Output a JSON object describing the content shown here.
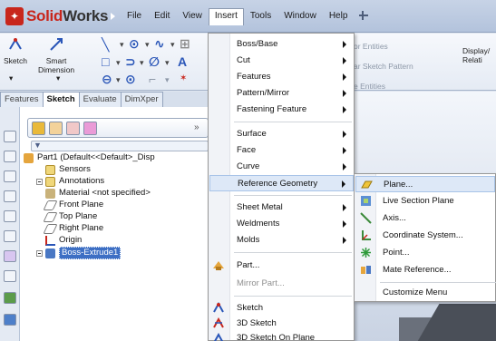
{
  "app": {
    "name_red": "Solid",
    "name_dark": "Works"
  },
  "menubar": {
    "menus": [
      "File",
      "Edit",
      "View",
      "Insert",
      "Tools",
      "Window",
      "Help"
    ],
    "active_index": 3
  },
  "ribbon": {
    "sketch_label": "Sketch",
    "smart_dim_label_1": "Smart",
    "smart_dim_label_2": "Dimension",
    "right_items": [
      "or Entities",
      "ar Sketch Pattern",
      "e Entities"
    ],
    "display_label_1": "Display/",
    "display_label_2": "Relati"
  },
  "tabs": [
    "Features",
    "Sketch",
    "Evaluate",
    "DimXper"
  ],
  "selected_tab": 1,
  "tree": {
    "part": "Part1  (Default<<Default>_Disp",
    "nodes": [
      "Sensors",
      "Annotations",
      "Material <not specified>",
      "Front Plane",
      "Top Plane",
      "Right Plane",
      "Origin",
      "Boss-Extrude1"
    ]
  },
  "insert_menu": {
    "items": [
      {
        "label": "Boss/Base",
        "submenu": true
      },
      {
        "label": "Cut",
        "submenu": true
      },
      {
        "label": "Features",
        "submenu": true
      },
      {
        "label": "Pattern/Mirror",
        "submenu": true
      },
      {
        "label": "Fastening Feature",
        "submenu": true
      },
      {
        "label": "Surface",
        "submenu": true
      },
      {
        "label": "Face",
        "submenu": true
      },
      {
        "label": "Curve",
        "submenu": true
      },
      {
        "label": "Reference Geometry",
        "submenu": true
      },
      {
        "label": "Sheet Metal",
        "submenu": true
      },
      {
        "label": "Weldments",
        "submenu": true
      },
      {
        "label": "Molds",
        "submenu": true
      },
      {
        "label": "Part...",
        "submenu": false
      },
      {
        "label": "Mirror Part...",
        "submenu": false
      },
      {
        "label": "Sketch",
        "submenu": false
      },
      {
        "label": "3D Sketch",
        "submenu": false
      },
      {
        "label": "3D Sketch On Plane",
        "submenu": false
      }
    ]
  },
  "reference_geometry_submenu": {
    "items": [
      "Plane...",
      "Live Section Plane",
      "Axis...",
      "Coordinate System...",
      "Point...",
      "Mate Reference...",
      "Customize Menu"
    ]
  },
  "colors": {
    "accent_red": "#c8261c",
    "selection_blue": "#3d6fc4",
    "menu_highlight": "#dde8f7"
  }
}
